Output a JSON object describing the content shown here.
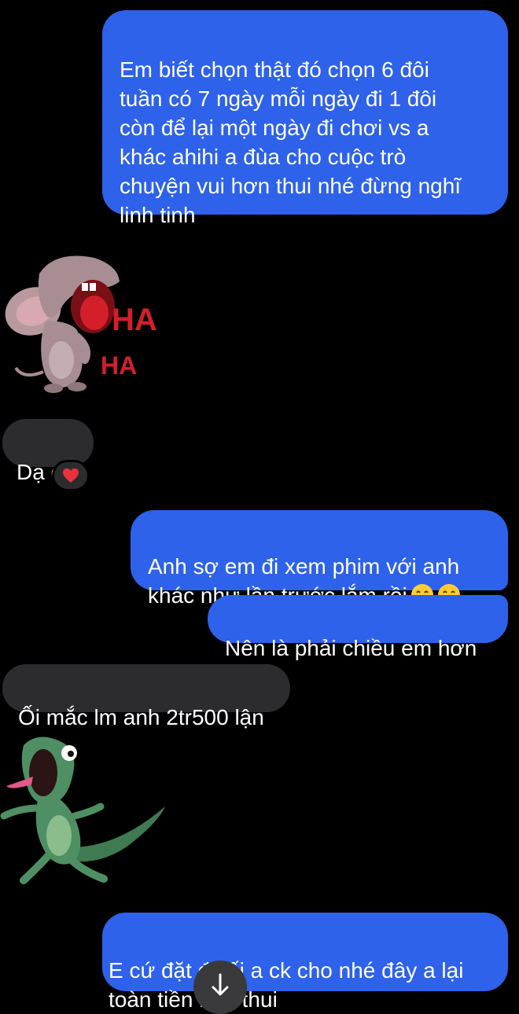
{
  "messages": {
    "out_1": "Em biết chọn thật đó chọn 6 đôi\ntuần có 7 ngày mỗi ngày đi 1 đôi\ncòn để lại một ngày đi chơi vs a\nkhác ahihi a đùa cho cuộc trò\nchuyện vui hơn thui nhé đừng nghĩ\nlinh tinh",
    "in_1": "Dạ dạ",
    "in_1_reaction": "heart",
    "out_2": "Anh sợ em đi xem phim với anh\nkhác như lần trước lắm rồi",
    "out_2_emojis": [
      "grinning-face",
      "grinning-face"
    ],
    "out_3": "Nên là phải chiều em hơn",
    "in_2": "Ối mắc lm anh 2tr500 lận",
    "out_4": "E cứ đặt đi tối a ck cho nhé đây a lại\ntoàn tiền mặt thui"
  },
  "stickers": {
    "mouse_text_1": "HA",
    "mouse_text_2": "HA"
  },
  "colors": {
    "background": "#000000",
    "outgoing_bubble": "#2e62ea",
    "incoming_bubble": "#2c2c2e",
    "heart": "#e8323c"
  },
  "icons": {
    "scroll_down": "arrow-down-icon",
    "reaction": "heart-icon",
    "emoji": "grinning-face-icon"
  }
}
